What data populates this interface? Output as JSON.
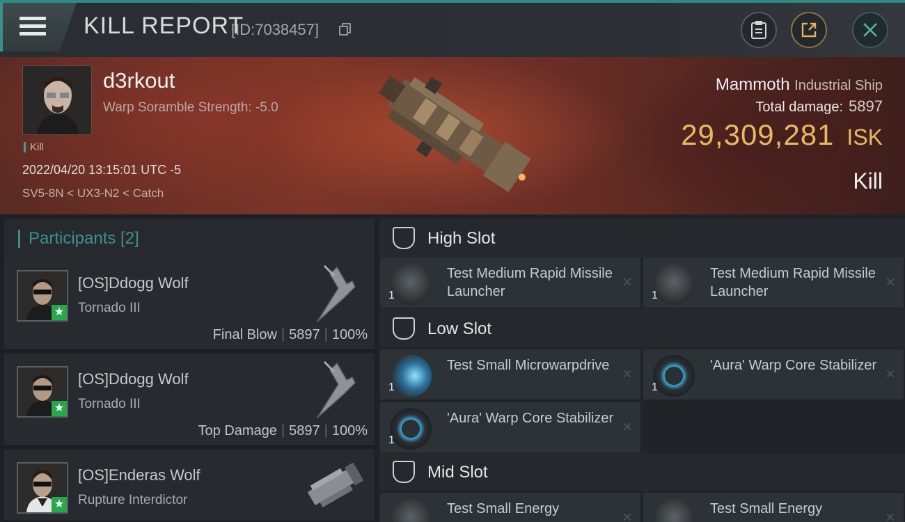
{
  "header": {
    "title": "KILL REPORT",
    "report_id": "[ID:7038457]"
  },
  "victim": {
    "name": "d3rkout",
    "subtitle": "Warp Soramble Strength: -5.0",
    "tag": "Kill",
    "datetime": "2022/04/20 13:15:01 UTC -5",
    "location": "SV5-8N < UX3-N2 < Catch"
  },
  "ship": {
    "name": "Mammoth",
    "class": "Industrial Ship",
    "total_damage_label": "Total damage:",
    "total_damage": "5897",
    "isk_value": "29,309,281",
    "isk_unit": "ISK",
    "result": "Kill"
  },
  "participants": {
    "header": "Participants [2]",
    "items": [
      {
        "name": "[OS]Ddogg Wolf",
        "ship": "Tornado III",
        "role": "Final Blow",
        "damage": "5897",
        "percent": "100%"
      },
      {
        "name": "[OS]Ddogg Wolf",
        "ship": "Tornado III",
        "role": "Top Damage",
        "damage": "5897",
        "percent": "100%"
      },
      {
        "name": "[OS]Enderas Wolf",
        "ship": "Rupture Interdictor"
      }
    ]
  },
  "fitting": {
    "high": {
      "label": "High Slot",
      "modules": [
        {
          "name": "Test Medium Rapid Missile Launcher",
          "qty": "1"
        },
        {
          "name": "Test Medium Rapid Missile Launcher",
          "qty": "1"
        }
      ]
    },
    "low": {
      "label": "Low Slot",
      "modules": [
        {
          "name": "Test Small Microwarpdrive",
          "qty": "1"
        },
        {
          "name": "'Aura' Warp Core Stabilizer",
          "qty": "1"
        },
        {
          "name": "'Aura' Warp Core Stabilizer",
          "qty": "1"
        }
      ]
    },
    "mid": {
      "label": "Mid Slot",
      "modules": [
        {
          "name": "Test Small Energy"
        },
        {
          "name": "Test Small Energy"
        }
      ]
    }
  },
  "icons": {
    "menu": "menu-icon",
    "copy": "copy-icon",
    "clipboard": "clipboard-icon",
    "share": "share-icon",
    "close": "close-icon",
    "remove": "×"
  },
  "colors": {
    "accent": "#3e8f8d",
    "isk": "#e8b965",
    "star": "#27a84a"
  }
}
